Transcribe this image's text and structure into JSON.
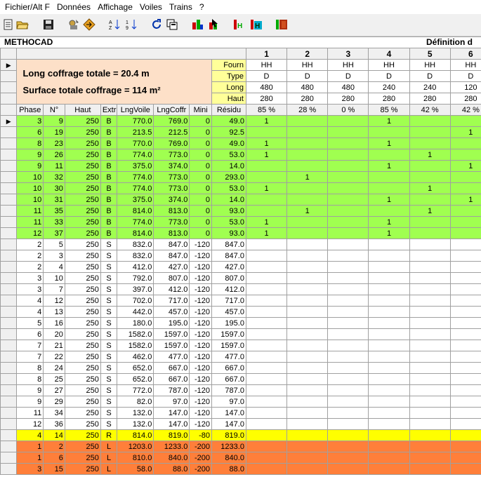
{
  "menu": [
    "Fichier/Alt F",
    "Données",
    "Affichage",
    "Voiles",
    "Trains",
    "?"
  ],
  "toolbar_icons": [
    "new-document-icon",
    "open-folder-icon",
    "save-icon",
    "config-tools-icon",
    "navigate-icon",
    "sort-az-icon",
    "sort-number-icon",
    "refresh-icon",
    "copy-window-icon",
    "bar-chart-red-icon",
    "bar-chart-pointer-icon",
    "column-h-icon",
    "column-h-color-icon",
    "panels-icon"
  ],
  "title": "METHOCAD",
  "title_right": "Définition d",
  "summary": {
    "line1": "Long coffrage totale = 20.4 m",
    "line2": "Surface totale coffrage = 114 m²"
  },
  "columns": [
    "1",
    "2",
    "3",
    "4",
    "5",
    "6"
  ],
  "param_rows": [
    {
      "label": "Fourn",
      "values": [
        "HH",
        "HH",
        "HH",
        "HH",
        "HH",
        "HH"
      ]
    },
    {
      "label": "Type",
      "values": [
        "D",
        "D",
        "D",
        "D",
        "D",
        "D"
      ]
    },
    {
      "label": "Long",
      "values": [
        "480",
        "480",
        "480",
        "240",
        "240",
        "120"
      ]
    },
    {
      "label": "Haut",
      "values": [
        "280",
        "280",
        "280",
        "280",
        "280",
        "280"
      ]
    }
  ],
  "headers": [
    "Phase",
    "N°",
    "Haut",
    "Extr",
    "LngVoile",
    "LngCoffr",
    "Mini",
    "Résidu"
  ],
  "percents": [
    "85 %",
    "28 %",
    "0 %",
    "85 %",
    "42 %",
    "42 %"
  ],
  "rows": [
    {
      "color": "green",
      "cells": [
        "3",
        "9",
        "250",
        "B",
        "770.0",
        "769.0",
        "0",
        "49.0"
      ],
      "marks": [
        "1",
        "",
        "",
        "1",
        "",
        ""
      ]
    },
    {
      "color": "green",
      "cells": [
        "6",
        "19",
        "250",
        "B",
        "213.5",
        "212.5",
        "0",
        "92.5"
      ],
      "marks": [
        "",
        "",
        "",
        "",
        "",
        "1"
      ]
    },
    {
      "color": "green",
      "cells": [
        "8",
        "23",
        "250",
        "B",
        "770.0",
        "769.0",
        "0",
        "49.0"
      ],
      "marks": [
        "1",
        "",
        "",
        "1",
        "",
        ""
      ]
    },
    {
      "color": "green",
      "cells": [
        "9",
        "26",
        "250",
        "B",
        "774.0",
        "773.0",
        "0",
        "53.0"
      ],
      "marks": [
        "1",
        "",
        "",
        "",
        "1",
        ""
      ]
    },
    {
      "color": "green",
      "cells": [
        "9",
        "11",
        "250",
        "B",
        "375.0",
        "374.0",
        "0",
        "14.0"
      ],
      "marks": [
        "",
        "",
        "",
        "1",
        "",
        "1"
      ]
    },
    {
      "color": "green",
      "cells": [
        "10",
        "32",
        "250",
        "B",
        "774.0",
        "773.0",
        "0",
        "293.0"
      ],
      "marks": [
        "",
        "1",
        "",
        "",
        "",
        ""
      ]
    },
    {
      "color": "green",
      "cells": [
        "10",
        "30",
        "250",
        "B",
        "774.0",
        "773.0",
        "0",
        "53.0"
      ],
      "marks": [
        "1",
        "",
        "",
        "",
        "1",
        ""
      ]
    },
    {
      "color": "green",
      "cells": [
        "10",
        "31",
        "250",
        "B",
        "375.0",
        "374.0",
        "0",
        "14.0"
      ],
      "marks": [
        "",
        "",
        "",
        "1",
        "",
        "1"
      ]
    },
    {
      "color": "green",
      "cells": [
        "11",
        "35",
        "250",
        "B",
        "814.0",
        "813.0",
        "0",
        "93.0"
      ],
      "marks": [
        "",
        "1",
        "",
        "",
        "1",
        ""
      ]
    },
    {
      "color": "green",
      "cells": [
        "11",
        "33",
        "250",
        "B",
        "774.0",
        "773.0",
        "0",
        "53.0"
      ],
      "marks": [
        "1",
        "",
        "",
        "1",
        "",
        ""
      ]
    },
    {
      "color": "green",
      "cells": [
        "12",
        "37",
        "250",
        "B",
        "814.0",
        "813.0",
        "0",
        "93.0"
      ],
      "marks": [
        "1",
        "",
        "",
        "1",
        "",
        ""
      ]
    },
    {
      "color": "white",
      "cells": [
        "2",
        "5",
        "250",
        "S",
        "832.0",
        "847.0",
        "-120",
        "847.0"
      ],
      "marks": [
        "",
        "",
        "",
        "",
        "",
        ""
      ]
    },
    {
      "color": "white",
      "cells": [
        "2",
        "3",
        "250",
        "S",
        "832.0",
        "847.0",
        "-120",
        "847.0"
      ],
      "marks": [
        "",
        "",
        "",
        "",
        "",
        ""
      ]
    },
    {
      "color": "white",
      "cells": [
        "2",
        "4",
        "250",
        "S",
        "412.0",
        "427.0",
        "-120",
        "427.0"
      ],
      "marks": [
        "",
        "",
        "",
        "",
        "",
        ""
      ]
    },
    {
      "color": "white",
      "cells": [
        "3",
        "10",
        "250",
        "S",
        "792.0",
        "807.0",
        "-120",
        "807.0"
      ],
      "marks": [
        "",
        "",
        "",
        "",
        "",
        ""
      ]
    },
    {
      "color": "white",
      "cells": [
        "3",
        "7",
        "250",
        "S",
        "397.0",
        "412.0",
        "-120",
        "412.0"
      ],
      "marks": [
        "",
        "",
        "",
        "",
        "",
        ""
      ]
    },
    {
      "color": "white",
      "cells": [
        "4",
        "12",
        "250",
        "S",
        "702.0",
        "717.0",
        "-120",
        "717.0"
      ],
      "marks": [
        "",
        "",
        "",
        "",
        "",
        ""
      ]
    },
    {
      "color": "white",
      "cells": [
        "4",
        "13",
        "250",
        "S",
        "442.0",
        "457.0",
        "-120",
        "457.0"
      ],
      "marks": [
        "",
        "",
        "",
        "",
        "",
        ""
      ]
    },
    {
      "color": "white",
      "cells": [
        "5",
        "16",
        "250",
        "S",
        "180.0",
        "195.0",
        "-120",
        "195.0"
      ],
      "marks": [
        "",
        "",
        "",
        "",
        "",
        ""
      ]
    },
    {
      "color": "white",
      "cells": [
        "6",
        "20",
        "250",
        "S",
        "1582.0",
        "1597.0",
        "-120",
        "1597.0"
      ],
      "marks": [
        "",
        "",
        "",
        "",
        "",
        ""
      ]
    },
    {
      "color": "white",
      "cells": [
        "7",
        "21",
        "250",
        "S",
        "1582.0",
        "1597.0",
        "-120",
        "1597.0"
      ],
      "marks": [
        "",
        "",
        "",
        "",
        "",
        ""
      ]
    },
    {
      "color": "white",
      "cells": [
        "7",
        "22",
        "250",
        "S",
        "462.0",
        "477.0",
        "-120",
        "477.0"
      ],
      "marks": [
        "",
        "",
        "",
        "",
        "",
        ""
      ]
    },
    {
      "color": "white",
      "cells": [
        "8",
        "24",
        "250",
        "S",
        "652.0",
        "667.0",
        "-120",
        "667.0"
      ],
      "marks": [
        "",
        "",
        "",
        "",
        "",
        ""
      ]
    },
    {
      "color": "white",
      "cells": [
        "8",
        "25",
        "250",
        "S",
        "652.0",
        "667.0",
        "-120",
        "667.0"
      ],
      "marks": [
        "",
        "",
        "",
        "",
        "",
        ""
      ]
    },
    {
      "color": "white",
      "cells": [
        "9",
        "27",
        "250",
        "S",
        "772.0",
        "787.0",
        "-120",
        "787.0"
      ],
      "marks": [
        "",
        "",
        "",
        "",
        "",
        ""
      ]
    },
    {
      "color": "white",
      "cells": [
        "9",
        "29",
        "250",
        "S",
        "82.0",
        "97.0",
        "-120",
        "97.0"
      ],
      "marks": [
        "",
        "",
        "",
        "",
        "",
        ""
      ]
    },
    {
      "color": "white",
      "cells": [
        "11",
        "34",
        "250",
        "S",
        "132.0",
        "147.0",
        "-120",
        "147.0"
      ],
      "marks": [
        "",
        "",
        "",
        "",
        "",
        ""
      ]
    },
    {
      "color": "white",
      "cells": [
        "12",
        "36",
        "250",
        "S",
        "132.0",
        "147.0",
        "-120",
        "147.0"
      ],
      "marks": [
        "",
        "",
        "",
        "",
        "",
        ""
      ]
    },
    {
      "color": "yellow",
      "cells": [
        "4",
        "14",
        "250",
        "R",
        "814.0",
        "819.0",
        "-80",
        "819.0"
      ],
      "marks": [
        "",
        "",
        "",
        "",
        "",
        ""
      ]
    },
    {
      "color": "orange",
      "cells": [
        "1",
        "2",
        "250",
        "L",
        "1203.0",
        "1233.0",
        "-200",
        "1233.0"
      ],
      "marks": [
        "",
        "",
        "",
        "",
        "",
        ""
      ]
    },
    {
      "color": "orange",
      "cells": [
        "1",
        "6",
        "250",
        "L",
        "810.0",
        "840.0",
        "-200",
        "840.0"
      ],
      "marks": [
        "",
        "",
        "",
        "",
        "",
        ""
      ]
    },
    {
      "color": "orange",
      "cells": [
        "3",
        "15",
        "250",
        "L",
        "58.0",
        "88.0",
        "-200",
        "88.0"
      ],
      "marks": [
        "",
        "",
        "",
        "",
        "",
        ""
      ]
    }
  ],
  "colors": {
    "green": "#a0ff50",
    "yellow": "#ffff00",
    "orange": "#ff7f3a",
    "summary_bg": "#fde0c8",
    "label_bg": "#ffff99"
  }
}
